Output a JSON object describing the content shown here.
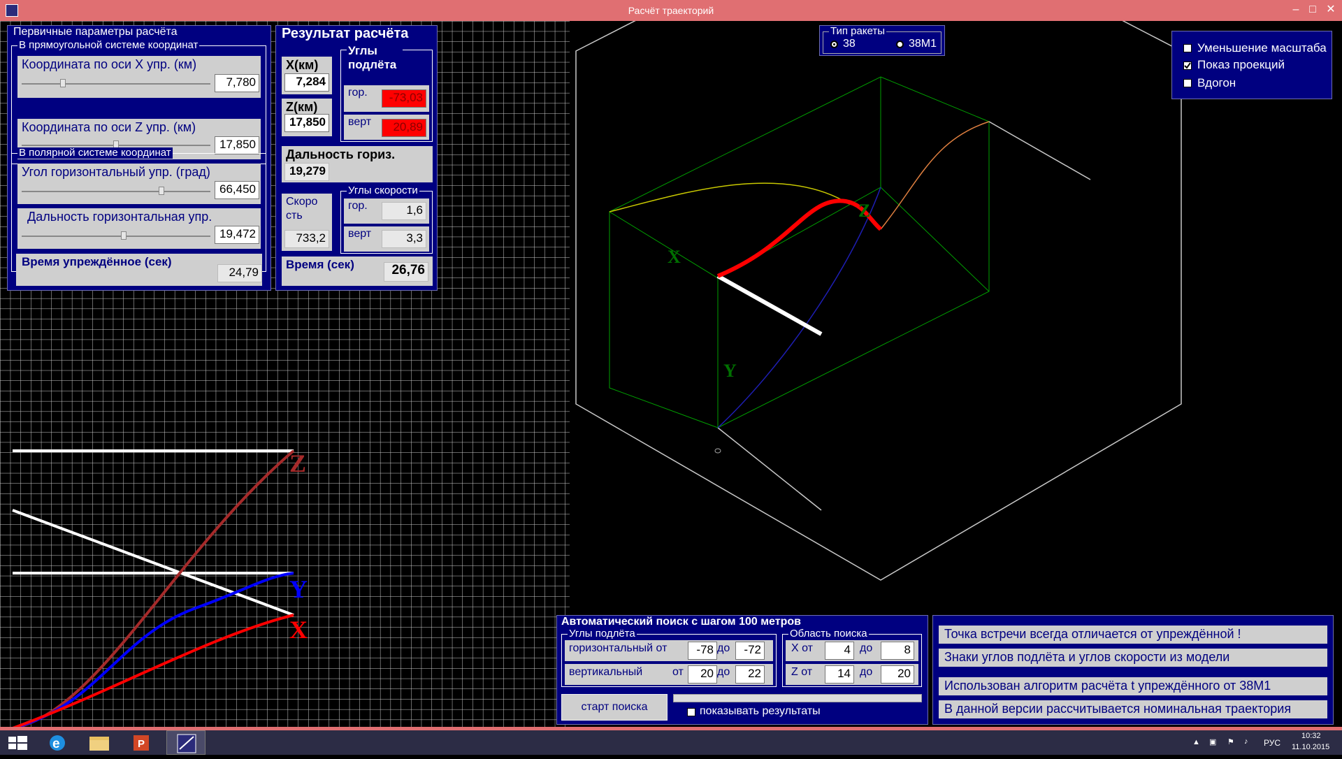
{
  "window": {
    "title": "Расчёт траекторий",
    "min": "–",
    "max": "□",
    "close": "✕"
  },
  "initial_params": {
    "caption": "Первичные параметры расчёта",
    "rect": {
      "caption": "В прямоугольной системе координат",
      "x_label": "Координата по оси X упр. (км)",
      "x_value": "7,780",
      "x_slider": 0.22,
      "z_label": "Координата по оси Z упр. (км)",
      "z_value": "17,850",
      "z_slider": 0.5
    },
    "polar": {
      "caption": "В полярной системе координат",
      "angle_label": "Угол горизонтальный упр. (град)",
      "angle_value": "66,450",
      "angle_slider": 0.74,
      "range_label": "Дальность горизонтальная упр.",
      "range_value": "19,472",
      "range_slider": 0.54
    },
    "time_label": "Время упреждённое (сек)",
    "time_value": "24,79"
  },
  "result": {
    "caption": "Результат расчёта",
    "x_label": "X(км)",
    "x_value": "7,284",
    "z_label": "Z(км)",
    "z_value": "17,850",
    "launch_angles": {
      "caption": "Углы подлёта",
      "hor_label": "гор.",
      "hor_value": "-73,03",
      "vert_label": "верт",
      "vert_value": "20,89"
    },
    "range_label": "Дальность гориз.",
    "range_value": "19,279",
    "speed_label": "Скоро сть",
    "speed_value": "733,2",
    "speed_angles": {
      "caption": "Углы скорости",
      "hor_label": "гор.",
      "hor_value": "1,6",
      "vert_label": "верт",
      "vert_value": "3,3"
    },
    "time_label": "Время (сек)",
    "time_value": "26,76"
  },
  "rocket_type": {
    "caption": "Тип ракеты",
    "opt1": "38",
    "opt2": "38М1",
    "selected": "38"
  },
  "options": {
    "opt1": "Уменьшение масштаба",
    "opt2": "Показ проекций",
    "opt3": "Вдогон",
    "checked": [
      "Показ проекций"
    ]
  },
  "axes_3d": {
    "x": "X",
    "y": "Y",
    "z": "Z"
  },
  "axes_2d": {
    "x": "X",
    "y": "Y",
    "z": "Z"
  },
  "auto_search": {
    "caption": "Автоматический поиск с шагом 100 метров",
    "angles": {
      "caption": "Углы подлёта",
      "hor_label": "горизонтальный от",
      "hor_from": "-78",
      "hor_to_label": "до",
      "hor_to": "-72",
      "vert_label": "вертикальный",
      "vert_from_label": "от",
      "vert_from": "20",
      "vert_to_label": "до",
      "vert_to": "22"
    },
    "area": {
      "caption": "Область поиска",
      "x_label": "X от",
      "x_from": "4",
      "x_to_label": "до",
      "x_to": "8",
      "z_label": "Z от",
      "z_from": "14",
      "z_to_label": "до",
      "z_to": "20"
    },
    "start_button": "старт поиска",
    "show_results": "показывать результаты"
  },
  "messages": [
    "Точка встречи всегда отличается от упреждённой !",
    "Знаки углов подлёта и углов скорости из модели",
    "Использован алгоритм расчёта t упреждённого от 38М1",
    "В данной версии рассчитывается номинальная траектория"
  ],
  "tray": {
    "lang": "РУС",
    "time": "10:32",
    "date": "11.10.2015"
  },
  "colors": {
    "panel": "#000080",
    "red": "#ff0000",
    "titlebar": "#e06f72"
  }
}
